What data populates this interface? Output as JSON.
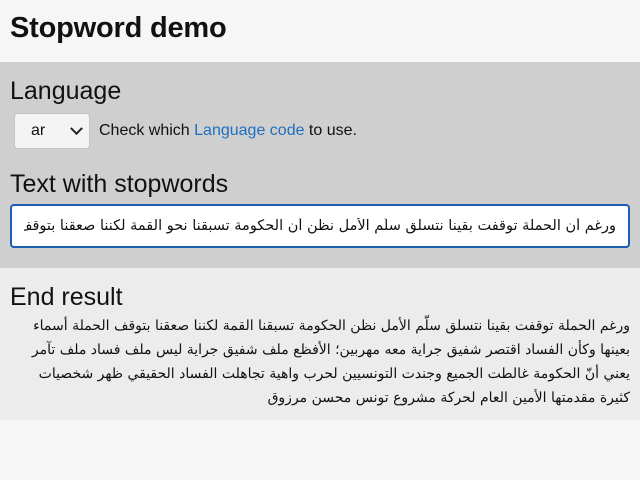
{
  "page": {
    "title": "Stopword demo"
  },
  "language_section": {
    "heading": "Language",
    "selected_language": "ar",
    "help_prefix": "Check which ",
    "help_link": "Language code",
    "help_suffix": " to use."
  },
  "text_section": {
    "heading": "Text with stopwords",
    "input_value": "ورغم أن الحملة توقفت بقينا نتسلق سلّم الأمل نظن أن الحكومة تسبقنا نحو القمة لكننا صعقنا بتوقف"
  },
  "result_section": {
    "heading": "End result",
    "text": "ورغم الحملة توقفت بقينا نتسلق سلّم الأمل نظن الحكومة تسبقنا القمة لكننا صعقنا بتوقف الحملة أسماء بعينها وكأن الفساد اقتصر شفيق جراية معه مهربين؛ الأفظع ملف شفيق جراية ليس ملف فساد ملف تآمر يعني أنّ الحكومة غالطت الجميع وجندت التونسيين لحرب واهية تجاهلت الفساد الحقيقي ظهر شخصيات كثيرة مقدمتها الأمين العام لحركة مشروع تونس محسن مرزوق"
  }
}
